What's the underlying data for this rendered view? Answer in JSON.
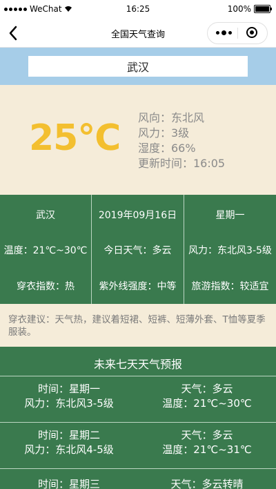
{
  "statusbar": {
    "carrier": "WeChat",
    "time": "16:25",
    "battery": "100%"
  },
  "nav": {
    "title": "全国天气查询"
  },
  "search": {
    "city": "武汉"
  },
  "current": {
    "temperature": "25℃",
    "wind_direction": "风向：东北风",
    "wind_power": "风力：3级",
    "humidity": "湿度：66%",
    "update_time": "更新时间：16:05"
  },
  "info": {
    "city": "武汉",
    "date": "2019年09月16日",
    "weekday": "星期一",
    "temp_range": "温度：21℃~30℃",
    "today_weather": "今日天气：多云",
    "wind": "风力：东北风3-5级",
    "dress_index": "穿衣指数：热",
    "uv": "紫外线强度：中等",
    "travel": "旅游指数：较适宜"
  },
  "advice": {
    "text": "穿衣建议：天气热，建议着短裙、短裤、短薄外套、T恤等夏季服装。"
  },
  "forecast": {
    "title": "未来七天天气预报",
    "items": [
      {
        "day": "时间：星期一",
        "weather": "天气：多云",
        "wind": "风力：东北风3-5级",
        "temp": "温度：21℃~30℃"
      },
      {
        "day": "时间：星期二",
        "weather": "天气：多云",
        "wind": "风力：东北风4-5级",
        "temp": "温度：21℃~31℃"
      },
      {
        "day": "时间：星期三",
        "weather": "天气：多云转晴",
        "wind": "",
        "temp": ""
      }
    ]
  },
  "colors": {
    "accent_temp": "#f3bf2f",
    "green": "#3a7a4e",
    "cream": "#f5ecd9",
    "blue": "#a6cde8"
  }
}
